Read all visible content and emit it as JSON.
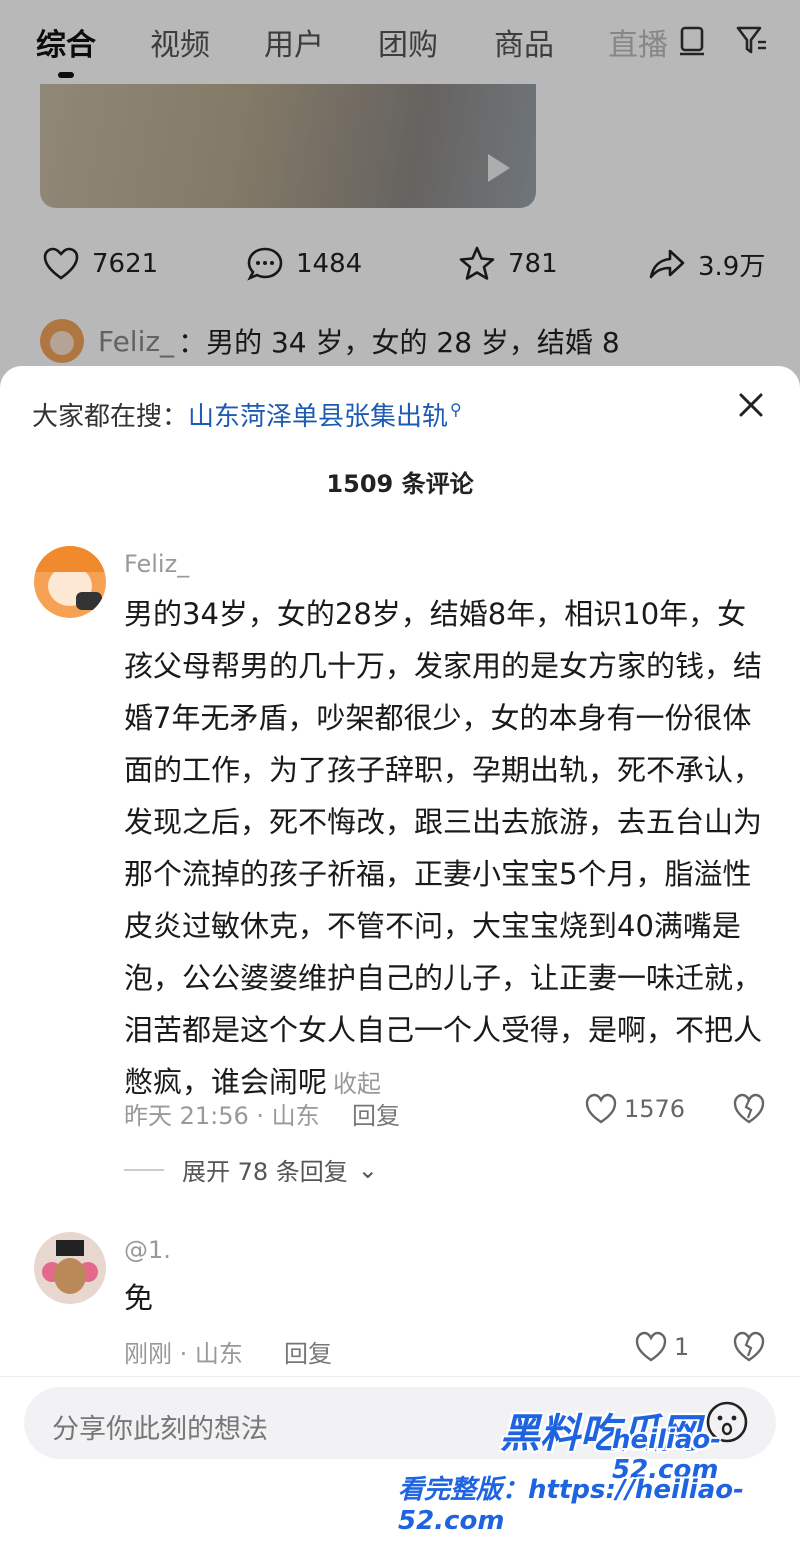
{
  "tabs": [
    "综合",
    "视频",
    "用户",
    "团购",
    "商品",
    "直播"
  ],
  "stats": {
    "likes": "7621",
    "comments": "1484",
    "favorites": "781",
    "shares": "3.9万"
  },
  "preview": {
    "name": "Feliz_",
    "text": "：男的 34 岁，女的 28 岁，结婚 8"
  },
  "sheet": {
    "search_prefix": "大家都在搜：",
    "search_keyword": "山东菏泽单县张集出轨",
    "comment_count": "1509 条评论"
  },
  "comments": [
    {
      "name": "Feliz_",
      "text": "男的34岁，女的28岁，结婚8年，相识10年，女孩父母帮男的几十万，发家用的是女方家的钱，结婚7年无矛盾，吵架都很少，女的本身有一份很体面的工作，为了孩子辞职，孕期出轨，死不承认，发现之后，死不悔改，跟三出去旅游，去五台山为那个流掉的孩子祈福，正妻小宝宝5个月，脂溢性皮炎过敏休克，不管不问，大宝宝烧到40满嘴是泡，公公婆婆维护自己的儿子，让正妻一味迁就，泪苦都是这个女人自己一个人受得，是啊，不把人憋疯，谁会闹呢",
      "collapse": "收起",
      "meta": "昨天 21:56 · 山东",
      "reply": "回复",
      "likes": "1576",
      "expand": "展开 78 条回复"
    },
    {
      "name": "@1.",
      "text": "免",
      "meta": "刚刚 · 山东",
      "reply": "回复",
      "likes": "1"
    }
  ],
  "input_placeholder": "分享你此刻的想法",
  "watermark": {
    "brand": "黑料吃瓜网",
    "domain": "heiliao-52.com",
    "line": "看完整版：https://heiliao-52.com"
  },
  "icons": [
    "heart-icon",
    "comment-icon",
    "star-icon",
    "share-icon",
    "close-icon",
    "broken-heart-icon",
    "emoji-icon",
    "filter-icon",
    "list-icon"
  ]
}
